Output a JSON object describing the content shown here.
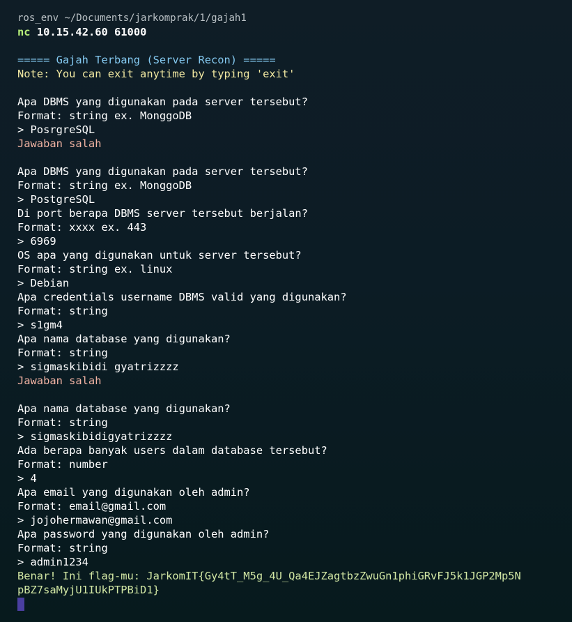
{
  "terminal": {
    "prompt": {
      "env": "ros_env",
      "path": "~/Documents/jarkomprak/1/gajah1"
    },
    "command": {
      "name": "nc",
      "args": "10.15.42.60 61000"
    },
    "banner": "===== Gajah Terbang (Server Recon) =====",
    "note": "Note: You can exit anytime by typing 'exit'",
    "q_dbms": "Apa DBMS yang digunakan pada server tersebut?",
    "fmt_dbms": "Format: string ex. MonggoDB",
    "ans_dbms_wrong": "> PosrgreSQL",
    "wrong_1": "Jawaban salah",
    "q_dbms_2": "Apa DBMS yang digunakan pada server tersebut?",
    "fmt_dbms_2": "Format: string ex. MonggoDB",
    "ans_dbms": "> PostgreSQL",
    "q_port": "Di port berapa DBMS server tersebut berjalan?",
    "fmt_port": "Format: xxxx ex. 443",
    "ans_port": "> 6969",
    "q_os": "OS apa yang digunakan untuk server tersebut?",
    "fmt_os": "Format: string ex. linux",
    "ans_os": "> Debian",
    "q_user": "Apa credentials username DBMS valid yang digunakan?",
    "fmt_user": "Format: string",
    "ans_user": "> s1gm4",
    "q_db": "Apa nama database yang digunakan?",
    "fmt_db": "Format: string",
    "ans_db_wrong": "> sigmaskibidi gyatrizzzz",
    "wrong_2": "Jawaban salah",
    "q_db_2": "Apa nama database yang digunakan?",
    "fmt_db_2": "Format: string",
    "ans_db": "> sigmaskibidigyatrizzzz",
    "q_users": "Ada berapa banyak users dalam database tersebut?",
    "fmt_users": "Format: number",
    "ans_users": "> 4",
    "q_email": "Apa email yang digunakan oleh admin?",
    "fmt_email": "Format: email@gmail.com",
    "ans_email": "> jojohermawan@gmail.com",
    "q_pass": "Apa password yang digunakan oleh admin?",
    "fmt_pass": "Format: string",
    "ans_pass": "> admin1234",
    "success_1": "Benar! Ini flag-mu: JarkomIT{Gy4tT_M5g_4U_Qa4EJZagtbzZwuGn1phiGRvFJ5k1JGP2Mp5N",
    "success_2": "pBZ7saMyjU1IUkPTPBiD1}"
  },
  "colors": {
    "background": "#0c1c25",
    "command": "#b8f07a",
    "banner": "#84c9f0",
    "note": "#f2e9a2",
    "error": "#f3b4a4",
    "success": "#d2e7a4",
    "cursor": "#4a3fa0"
  }
}
